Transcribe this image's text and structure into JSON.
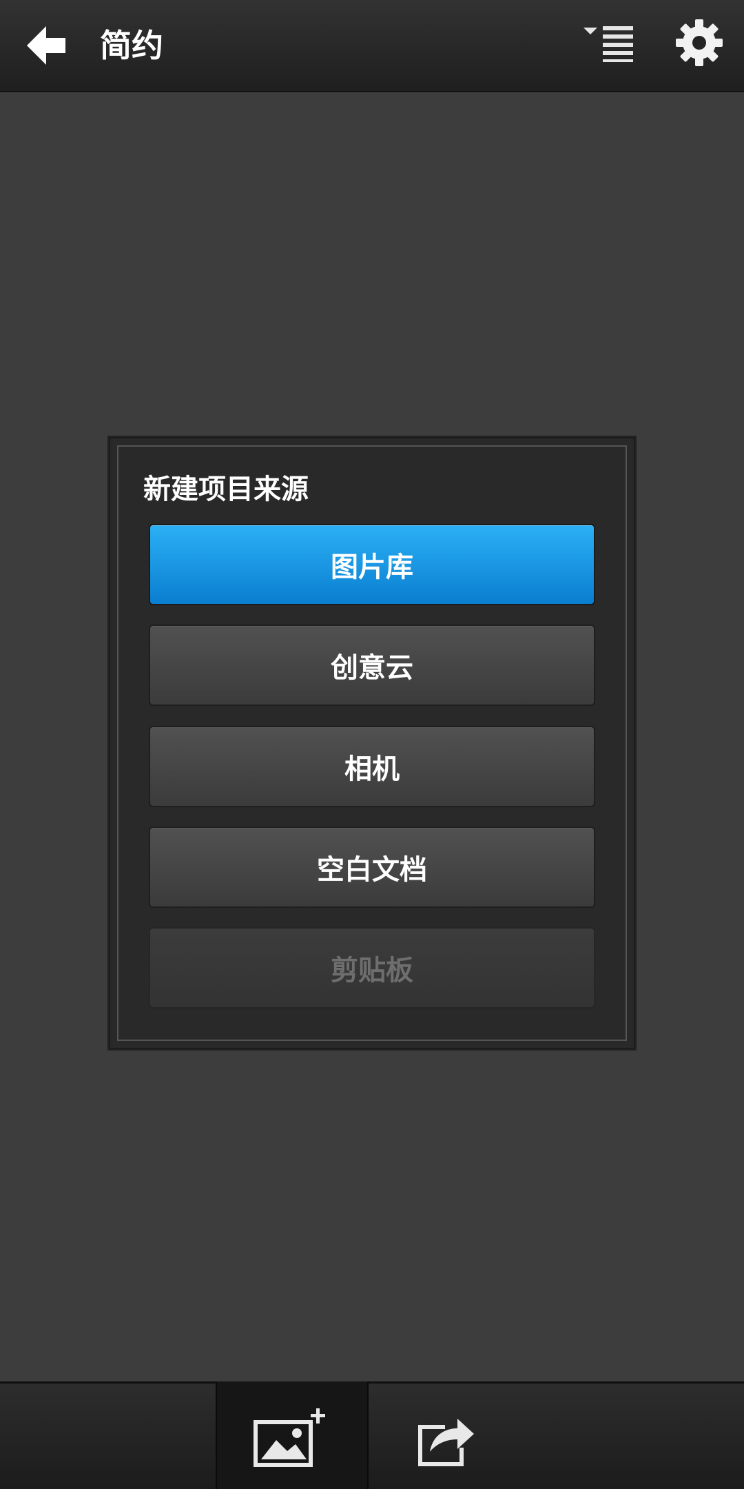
{
  "header": {
    "title": "简约",
    "back_icon": "arrow-left-icon",
    "menu_icon": "list-sort-icon",
    "settings_icon": "gear-icon"
  },
  "dialog": {
    "title": "新建项目来源",
    "options": [
      {
        "label": "图片库",
        "state": "selected"
      },
      {
        "label": "创意云",
        "state": "normal"
      },
      {
        "label": "相机",
        "state": "normal"
      },
      {
        "label": "空白文档",
        "state": "normal"
      },
      {
        "label": "剪贴板",
        "state": "disabled"
      }
    ]
  },
  "bottom_bar": {
    "add_image_icon": "add-image-icon",
    "share_icon": "share-icon"
  },
  "colors": {
    "background": "#3d3d3d",
    "accent": "#1a9be6",
    "dialog_bg": "#292929",
    "disabled_text": "#6e6e6e"
  }
}
